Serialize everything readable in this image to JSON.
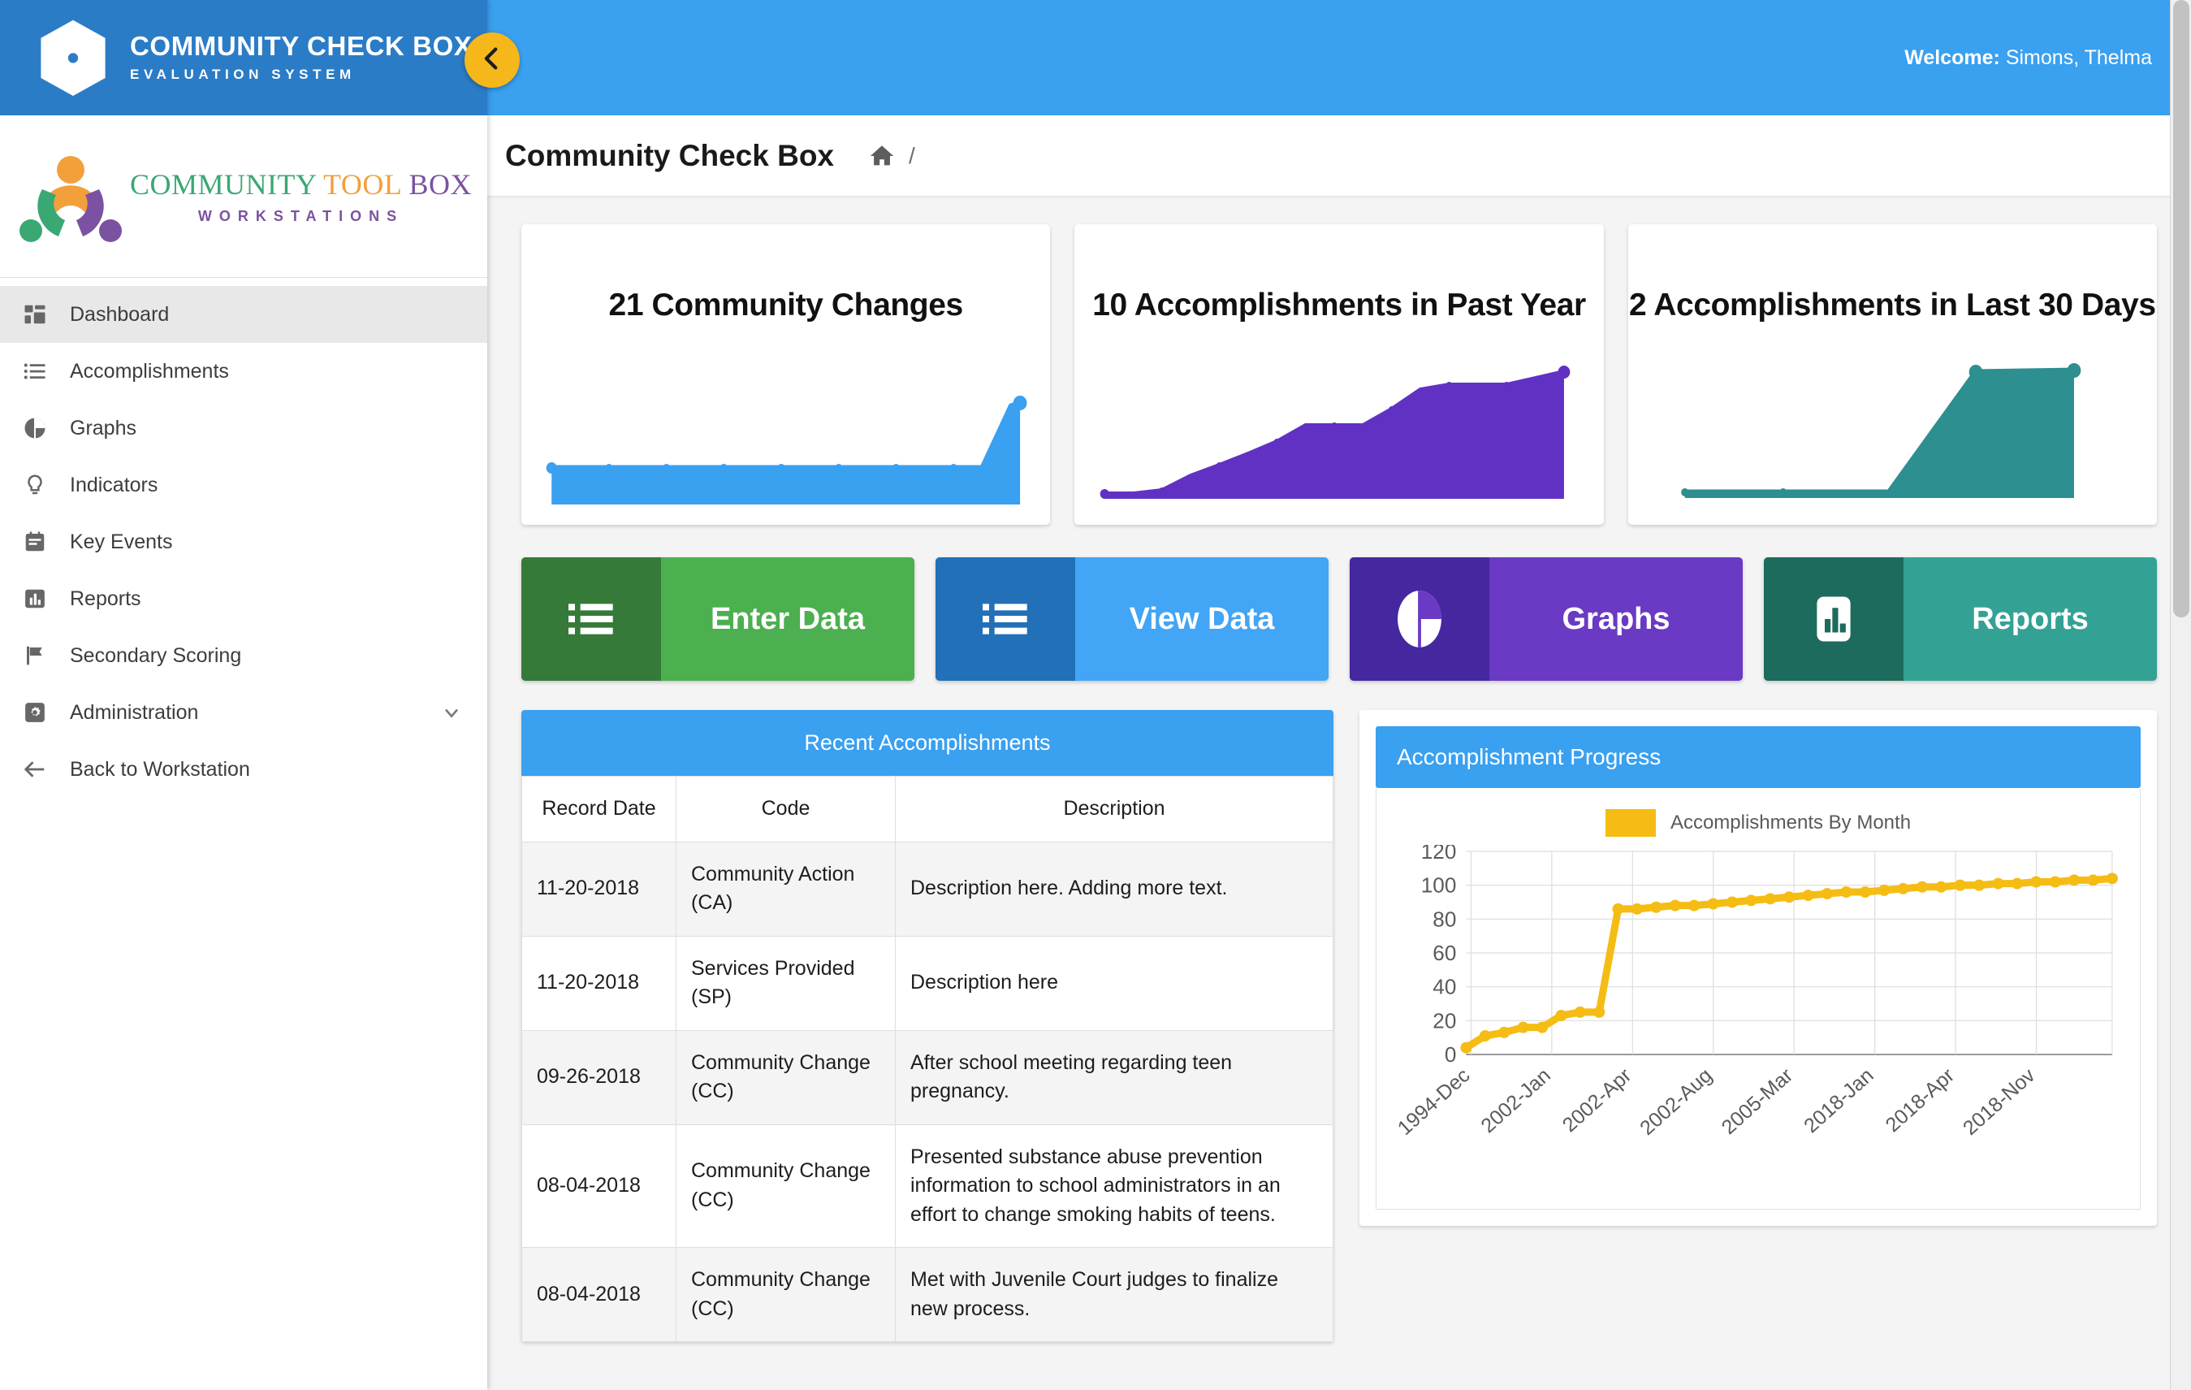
{
  "brand": {
    "title": "COMMUNITY CHECK BOX",
    "subtitle": "EVALUATION SYSTEM",
    "logo_icon": "hexagon-check-logo"
  },
  "workstation_logo": {
    "word1": "COMMUNITY",
    "word2": "TOOL",
    "word3": "BOX",
    "word4": "WORKSTATIONS",
    "icon": "community-people-logo"
  },
  "sidebar": {
    "collapse_icon": "chevron-left-icon",
    "items": [
      {
        "label": "Dashboard",
        "icon": "dashboard-icon",
        "active": true
      },
      {
        "label": "Accomplishments",
        "icon": "list-icon",
        "active": false
      },
      {
        "label": "Graphs",
        "icon": "pie-chart-icon",
        "active": false
      },
      {
        "label": "Indicators",
        "icon": "lightbulb-icon",
        "active": false
      },
      {
        "label": "Key Events",
        "icon": "calendar-icon",
        "active": false
      },
      {
        "label": "Reports",
        "icon": "bar-chart-icon",
        "active": false
      },
      {
        "label": "Secondary Scoring",
        "icon": "flag-icon",
        "active": false
      },
      {
        "label": "Administration",
        "icon": "gear-icon",
        "active": false,
        "caret": "chevron-down-icon"
      },
      {
        "label": "Back to Workstation",
        "icon": "arrow-left-icon",
        "active": false
      }
    ]
  },
  "header": {
    "welcome_label": "Welcome:",
    "user_name": "Simons, Thelma"
  },
  "breadcrumb": {
    "title": "Community Check Box",
    "home_icon": "home-icon",
    "separator": "/"
  },
  "stat_cards": [
    {
      "title": "21 Community Changes",
      "color": "#3aa0f0"
    },
    {
      "title": "10 Accomplishments in Past Year",
      "color": "#6131c4"
    },
    {
      "title": "2 Accomplishments in Last 30 Days",
      "color": "#2d8f8f"
    }
  ],
  "action_buttons": [
    {
      "label": "Enter Data",
      "icon": "list-icon",
      "bg": "#4caf50",
      "icon_bg": "#357a38"
    },
    {
      "label": "View Data",
      "icon": "list-icon",
      "bg": "#42a5f5",
      "icon_bg": "#2270b8"
    },
    {
      "label": "Graphs",
      "icon": "pie-chart-icon",
      "bg": "#6a3ac4",
      "icon_bg": "#4527a0"
    },
    {
      "label": "Reports",
      "icon": "bar-chart-icon",
      "bg": "#34a195",
      "icon_bg": "#1d6b5c"
    }
  ],
  "recent_accomplishments": {
    "panel_title": "Recent Accomplishments",
    "columns": [
      "Record Date",
      "Code",
      "Description"
    ],
    "rows": [
      {
        "date": "11-20-2018",
        "code": "Community Action (CA)",
        "description": "Description here. Adding more text."
      },
      {
        "date": "11-20-2018",
        "code": "Services Provided (SP)",
        "description": "Description here"
      },
      {
        "date": "09-26-2018",
        "code": "Community Change (CC)",
        "description": "After school meeting regarding teen pregnancy."
      },
      {
        "date": "08-04-2018",
        "code": "Community Change (CC)",
        "description": "Presented substance abuse prevention information to school administrators in an effort to change smoking habits of teens."
      },
      {
        "date": "08-04-2018",
        "code": "Community Change (CC)",
        "description": "Met with Juvenile Court judges to finalize new process."
      }
    ]
  },
  "progress_panel": {
    "panel_title": "Accomplishment Progress"
  },
  "chart_data": {
    "type": "line",
    "title": "Accomplishment Progress",
    "legend": [
      "Accomplishments By Month"
    ],
    "legend_position": "top-center",
    "series_color": "#f5bc14",
    "xlabel": "",
    "ylabel": "",
    "ylim": [
      0,
      120
    ],
    "yticks": [
      0,
      20,
      40,
      60,
      80,
      100,
      120
    ],
    "grid": true,
    "tick_labels": [
      "1994-Dec",
      "2002-Jan",
      "2002-Apr",
      "2002-Aug",
      "2005-Mar",
      "2018-Jan",
      "2018-Apr",
      "2018-Nov"
    ],
    "x": [
      "1994-Dec",
      "1996-Mar",
      "1998-Jun",
      "2000-Sep",
      "2001-Apr",
      "2001-Nov",
      "2002-Jan",
      "2002-Feb",
      "2002-Mar",
      "2002-Apr",
      "2002-May",
      "2002-Jun",
      "2002-Jul",
      "2002-Aug",
      "2002-Oct",
      "2003-Feb",
      "2003-Jul",
      "2004-Jan",
      "2004-Jun",
      "2005-Mar",
      "2006-Feb",
      "2008-Apr",
      "2010-Jun",
      "2012-Sep",
      "2014-Nov",
      "2016-May",
      "2018-Jan",
      "2018-Feb",
      "2018-Mar",
      "2018-Apr",
      "2018-Jun",
      "2018-Aug",
      "2018-Sep",
      "2018-Oct",
      "2018-Nov"
    ],
    "values": [
      4,
      11,
      13,
      16,
      16,
      23,
      25,
      25,
      86,
      86,
      87,
      88,
      88,
      89,
      90,
      91,
      92,
      93,
      94,
      95,
      96,
      96,
      97,
      98,
      99,
      99,
      100,
      100,
      101,
      101,
      102,
      102,
      103,
      103,
      104
    ],
    "sparklines": [
      {
        "name": "community-changes-sparkline",
        "color": "#3aa0f0",
        "values": [
          8,
          8,
          8,
          8,
          8,
          8,
          8,
          8,
          8,
          8,
          8,
          8,
          8,
          8,
          8,
          8,
          8,
          24
        ]
      },
      {
        "name": "accomplishments-past-year-sparkline",
        "color": "#6131c4",
        "values": [
          1,
          1,
          3,
          8,
          13,
          18,
          24,
          31,
          31,
          31,
          38,
          48,
          56,
          58,
          58,
          72
        ]
      },
      {
        "name": "accomplishments-30-days-sparkline",
        "color": "#2d8f8f",
        "values": [
          0,
          0,
          0,
          100,
          100
        ]
      }
    ]
  },
  "scrollbar": {
    "name": "vertical-scrollbar"
  }
}
